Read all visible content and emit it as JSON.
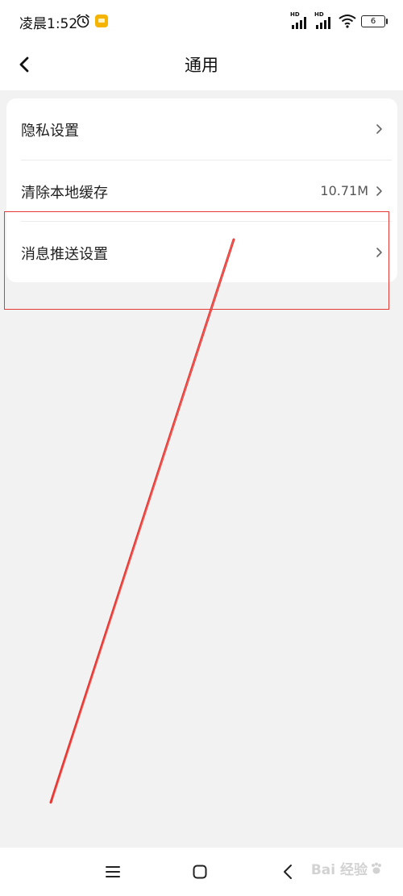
{
  "status_bar": {
    "time": "凌晨1:52",
    "signal_1_tag": "HD",
    "signal_2_tag": "HD",
    "battery_level": "6",
    "icons": [
      "alarm-icon",
      "notification-app-icon",
      "signal-icon",
      "wifi-icon",
      "battery-icon"
    ]
  },
  "header": {
    "title": "通用",
    "back_icon": "chevron-left-icon"
  },
  "settings": {
    "items": [
      {
        "label": "隐私设置",
        "value": ""
      },
      {
        "label": "清除本地缓存",
        "value": "10.71M"
      },
      {
        "label": "消息推送设置",
        "value": ""
      }
    ]
  },
  "annotation": {
    "highlight_color": "#e53935"
  },
  "bottom_nav": {
    "icons": [
      "menu-icon",
      "home-icon",
      "back-icon"
    ]
  },
  "watermark": {
    "text": "Bai 经验"
  },
  "colors": {
    "page_background": "#f2f2f2",
    "card_background": "#ffffff",
    "accent_red": "#e53935"
  }
}
